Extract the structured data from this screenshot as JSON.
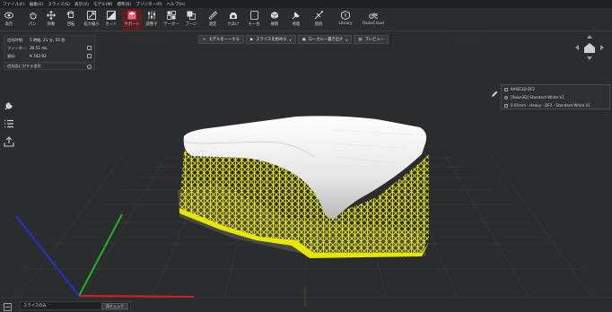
{
  "menu": [
    "ファイル(F)",
    "編集(E)",
    "スライス(S)",
    "表示(V)",
    "モデル(M)",
    "標準(B)",
    "プリンター(P)",
    "ヘルプ(H)"
  ],
  "toolbar": [
    {
      "label": "表示",
      "icon": "eye-icon"
    },
    {
      "label": "パン",
      "icon": "pan-icon"
    },
    {
      "label": "移動",
      "icon": "move-icon"
    },
    {
      "label": "回転",
      "icon": "rotate-icon"
    },
    {
      "label": "拡大縮小",
      "icon": "scale-icon"
    },
    {
      "label": "カット",
      "icon": "cut-icon"
    },
    {
      "label": "サポート",
      "icon": "support-icon",
      "active": true
    },
    {
      "label": "調整子",
      "icon": "adjust-icon"
    },
    {
      "label": "テーター",
      "icon": "grid-icon"
    },
    {
      "label": "ブーン",
      "icon": "bone-icon"
    },
    {
      "label": "測定",
      "icon": "measure-icon"
    },
    {
      "label": "穴あけ",
      "icon": "hole-icon"
    },
    {
      "label": "モー也",
      "icon": "model-icon"
    },
    {
      "label": "複製",
      "icon": "duplicate-icon"
    },
    {
      "label": "修復",
      "icon": "repair-icon"
    },
    {
      "label": "接続",
      "icon": "connect-icon"
    },
    {
      "label": "Library",
      "icon": "library-icon"
    },
    {
      "label": "RaiseCloud",
      "icon": "cloud-icon"
    }
  ],
  "info": {
    "time_label": "造形時間:",
    "time_value": "5 時間, 21 分, 55 秒",
    "filament_label": "フィーター:",
    "filament_value": "30.51 mL",
    "cost_label": "資料:",
    "cost_value": "¥ 742.92",
    "refresh_label": "造形面に対する造形"
  },
  "actions": {
    "add_model": "モデルを一ーする",
    "slice": "スライスを始める",
    "local": "ローカル一書き出す",
    "preview": "プレビュー"
  },
  "printer": {
    "name": "RAISE3D DF2",
    "resin": "[Raise3D] Standard White V1",
    "profile": "0.05mm - Heavy - DF2 - Standard White V1"
  },
  "bottom": {
    "label": "スライスのみ",
    "dropdown": "再チェック"
  },
  "colors": {
    "accent": "#c8313a",
    "support": "#e6e600",
    "model": "#e8e8e8",
    "axis_x": "#d42020",
    "axis_y": "#1fb51f",
    "axis_z": "#2233cc"
  }
}
